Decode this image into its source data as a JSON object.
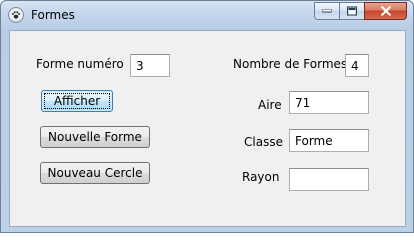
{
  "window": {
    "title": "Formes",
    "icon": "paw-icon"
  },
  "form": {
    "shape_number_label": "Forme numéro",
    "shape_number_value": "3",
    "shape_count_label": "Nombre de Formes",
    "shape_count_value": "4",
    "area_label": "Aire",
    "area_value": "71",
    "class_label": "Classe",
    "class_value": "Forme",
    "radius_label": "Rayon",
    "radius_value": ""
  },
  "buttons": {
    "show_label": "Afficher",
    "new_shape_label": "Nouvelle Forme",
    "new_circle_label": "Nouveau Cercle"
  }
}
